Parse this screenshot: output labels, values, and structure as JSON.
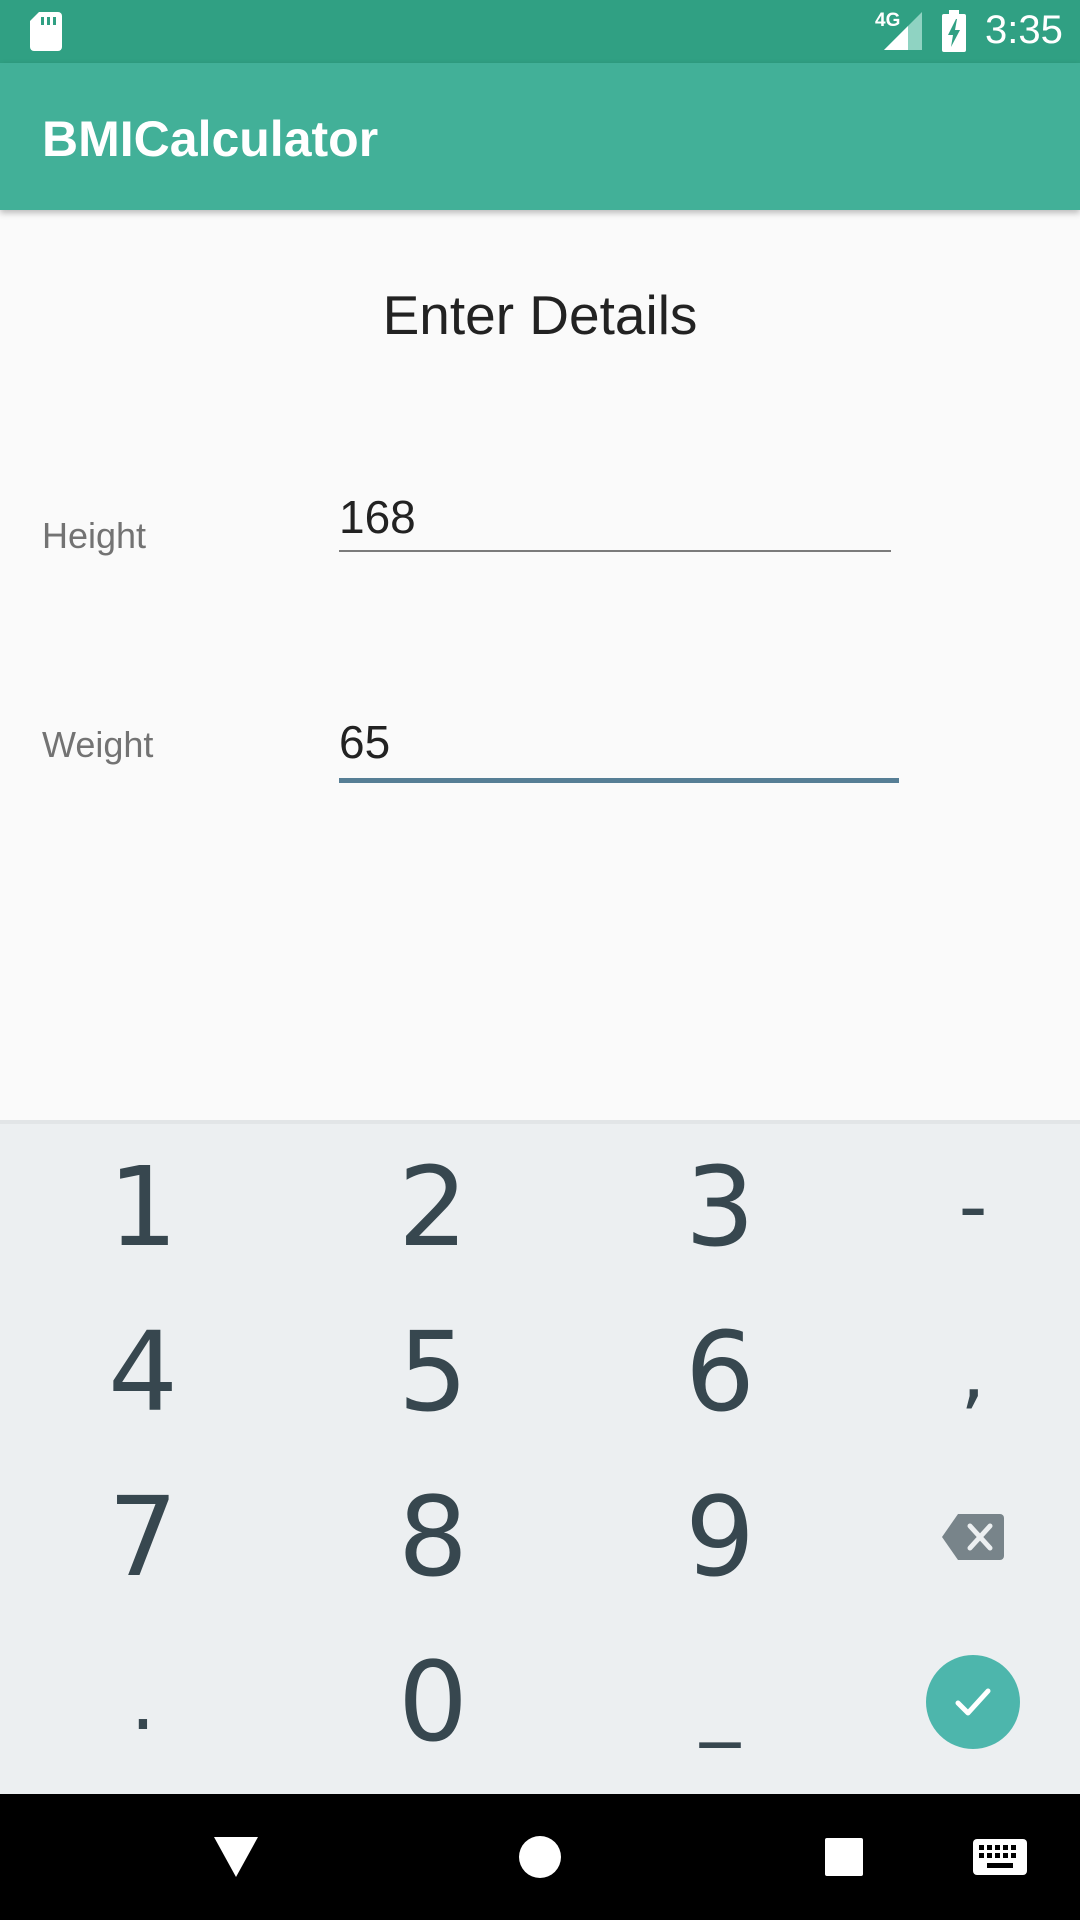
{
  "status_bar": {
    "network_label": "4G",
    "time": "3:35",
    "icons": [
      "sd-card-icon",
      "signal-icon",
      "battery-charging-icon"
    ]
  },
  "app_bar": {
    "title": "BMICalculator",
    "color": "#42b098"
  },
  "form": {
    "heading": "Enter Details",
    "height_label": "Height",
    "height_value": "168",
    "weight_label": "Weight",
    "weight_value": "65",
    "focused_field": "weight"
  },
  "keyboard": {
    "rows": [
      [
        "1",
        "2",
        "3",
        "-"
      ],
      [
        "4",
        "5",
        "6",
        ","
      ],
      [
        "7",
        "8",
        "9",
        "backspace-icon"
      ],
      [
        ".",
        "0",
        "_",
        "done-check-icon"
      ]
    ],
    "accent": "#4db6ac"
  },
  "nav_bar": {
    "icons": [
      "back-icon",
      "home-icon",
      "recents-icon",
      "keyboard-switch-icon"
    ]
  }
}
